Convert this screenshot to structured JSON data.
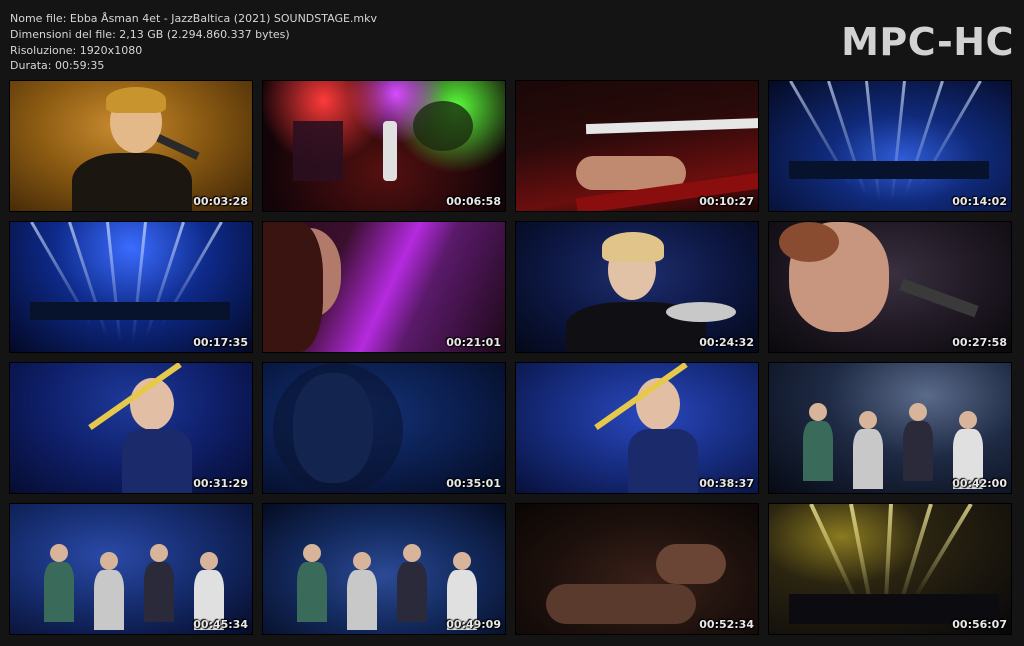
{
  "info": {
    "filename": "Nome file: Ebba Åsman 4et - JazzBaltica (2021) SOUNDSTAGE.mkv",
    "filesize": "Dimensioni del file: 2,13 GB (2.294.860.337 bytes)",
    "resolution": "Risoluzione: 1920x1080",
    "duration": "Durata: 00:59:35"
  },
  "logo": "MPC-HC",
  "thumbnails": [
    {
      "time": "00:03:28",
      "scene": "singer-amber"
    },
    {
      "time": "00:06:58",
      "scene": "stage-colorful"
    },
    {
      "time": "00:10:27",
      "scene": "keyboard-hand"
    },
    {
      "time": "00:14:02",
      "scene": "stage-blue-wide"
    },
    {
      "time": "00:17:35",
      "scene": "stage-blue-beams"
    },
    {
      "time": "00:21:01",
      "scene": "face-purple"
    },
    {
      "time": "00:24:32",
      "scene": "singer-blue"
    },
    {
      "time": "00:27:58",
      "scene": "singer-close"
    },
    {
      "time": "00:31:29",
      "scene": "trombone-blue"
    },
    {
      "time": "00:35:01",
      "scene": "face-dark-blue"
    },
    {
      "time": "00:38:37",
      "scene": "trombone-play"
    },
    {
      "time": "00:42:00",
      "scene": "band-spotlight"
    },
    {
      "time": "00:45:34",
      "scene": "band-front"
    },
    {
      "time": "00:49:09",
      "scene": "band-wide"
    },
    {
      "time": "00:52:34",
      "scene": "hands-dark"
    },
    {
      "time": "00:56:07",
      "scene": "stage-yellow-beams"
    }
  ]
}
